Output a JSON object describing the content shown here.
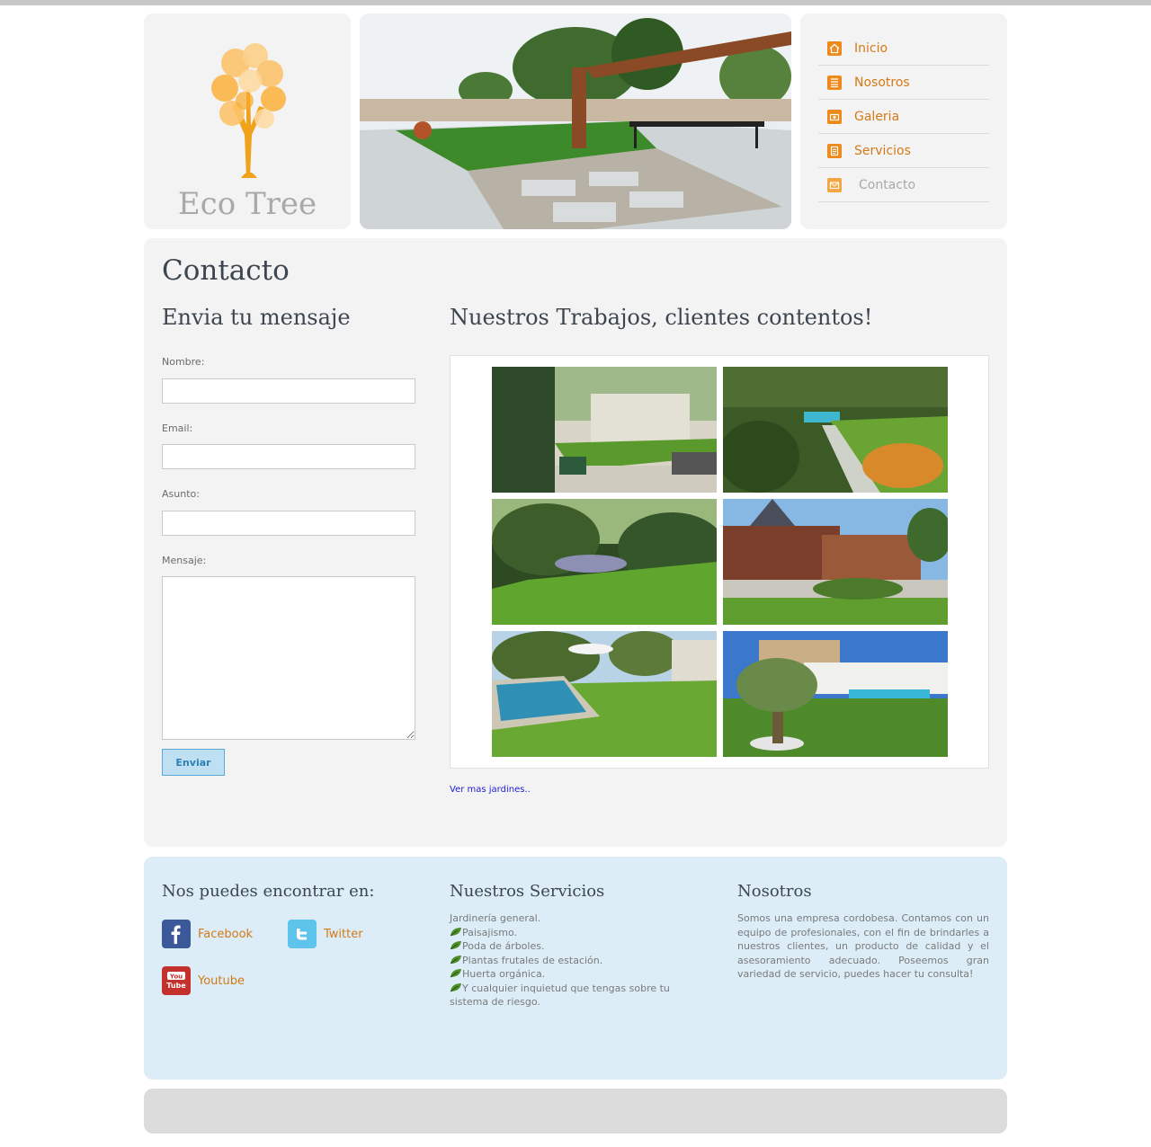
{
  "logo": {
    "text": "Eco Tree"
  },
  "nav": {
    "items": [
      {
        "label": "Inicio",
        "icon": "home-icon",
        "active": false
      },
      {
        "label": "Nosotros",
        "icon": "list-icon",
        "active": false
      },
      {
        "label": "Galeria",
        "icon": "camera-icon",
        "active": false
      },
      {
        "label": "Servicios",
        "icon": "document-icon",
        "active": false
      },
      {
        "label": "Contacto",
        "icon": "envelope-icon",
        "active": true
      }
    ]
  },
  "main": {
    "title": "Contacto",
    "form": {
      "title": "Envia tu mensaje",
      "name_label": "Nombre:",
      "email_label": "Email:",
      "subject_label": "Asunto:",
      "message_label": "Mensaje:",
      "name_value": "",
      "email_value": "",
      "subject_value": "",
      "message_value": "",
      "submit_label": "Enviar"
    },
    "gallery": {
      "title": "Nuestros Trabajos, clientes contentos!",
      "more_link": "Ver mas jardines.."
    }
  },
  "footer": {
    "social": {
      "title": "Nos puedes encontrar en:",
      "facebook": "Facebook",
      "twitter": "Twitter",
      "youtube": "Youtube"
    },
    "services": {
      "title": "Nuestros Servicios",
      "intro": "Jardinería general.",
      "items": [
        "Paisajismo.",
        "Poda de árboles.",
        "Plantas frutales de estación.",
        "Huerta orgánica.",
        "Y cualquier inquietud que tengas sobre tu sistema de riesgo."
      ]
    },
    "about": {
      "title": "Nosotros",
      "text": "Somos una empresa cordobesa. Contamos con un equipo de profesionales, con el fin de brindarles a nuestros clientes, un producto de calidad y el asesoramiento adecuado. Poseemos gran variedad de servicio, puedes hacer tu consulta!"
    }
  },
  "colors": {
    "accent_orange": "#d37a17",
    "panel_gray": "#f3f3f3",
    "footer_blue": "#dcedf8",
    "button_blue": "#bfe0f3"
  }
}
